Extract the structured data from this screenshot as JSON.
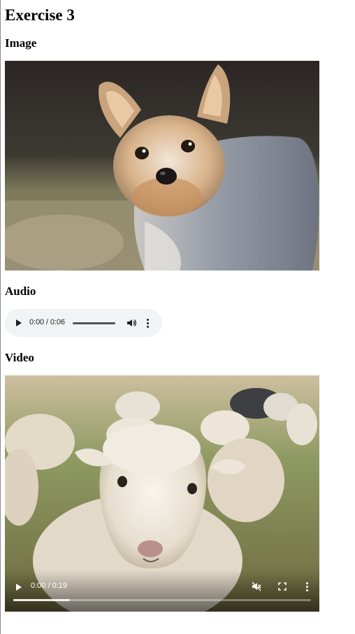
{
  "page": {
    "title": "Exercise 3",
    "image_heading": "Image",
    "audio_heading": "Audio",
    "video_heading": "Video"
  },
  "audio": {
    "time": "0:00 / 0:06",
    "progress": 0
  },
  "video": {
    "time": "0:00 / 0:19",
    "muted": true,
    "buffered_fraction": 0.19
  },
  "icons": {
    "audio_play": "play-icon",
    "audio_volume": "volume-icon",
    "audio_more": "more-options-icon",
    "video_play": "play-icon",
    "video_mute": "volume-muted-icon",
    "video_fullscreen": "fullscreen-icon",
    "video_more": "more-options-icon"
  }
}
